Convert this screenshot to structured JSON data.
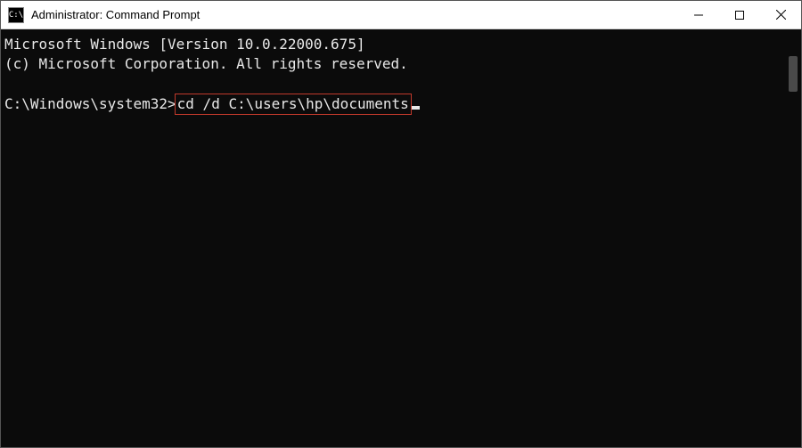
{
  "window": {
    "title": "Administrator: Command Prompt",
    "icon_label": "C:\\"
  },
  "terminal": {
    "line1": "Microsoft Windows [Version 10.0.22000.675]",
    "line2": "(c) Microsoft Corporation. All rights reserved.",
    "prompt": "C:\\Windows\\system32>",
    "command": "cd /d C:\\users\\hp\\documents"
  }
}
